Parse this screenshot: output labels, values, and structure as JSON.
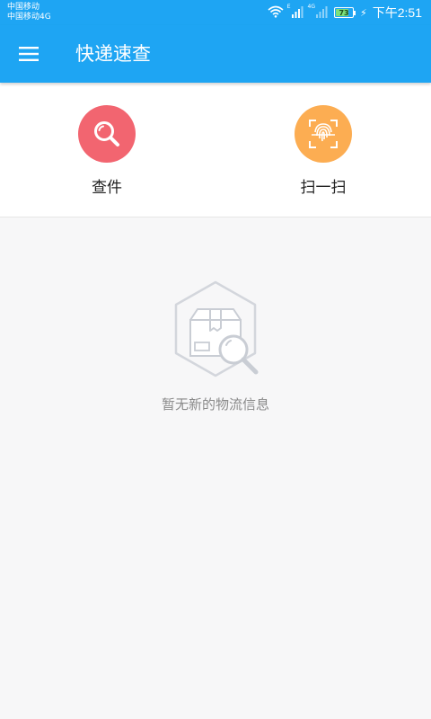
{
  "status_bar": {
    "carrier_primary": "中国移动",
    "carrier_secondary": "中国移动4G",
    "signal_labels": [
      "E",
      "4G"
    ],
    "battery_level": "73",
    "time": "下午2:51"
  },
  "toolbar": {
    "title": "快递速查",
    "menu_icon": "hamburger-menu-icon"
  },
  "actions": [
    {
      "label": "查件",
      "icon": "search-icon",
      "color": "#f26570"
    },
    {
      "label": "扫一扫",
      "icon": "fingerprint-scan-icon",
      "color": "#fcad52"
    }
  ],
  "empty_state": {
    "icon": "package-search-icon",
    "message": "暂无新的物流信息"
  },
  "colors": {
    "primary": "#1ea5f3",
    "background": "#f7f7f8",
    "panel": "#ffffff",
    "muted_text": "#8a8a8a"
  }
}
